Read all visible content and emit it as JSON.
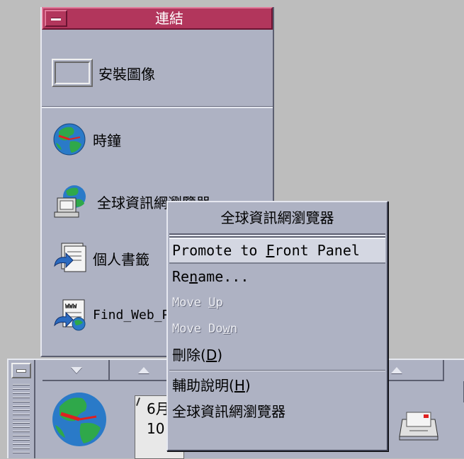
{
  "subpanel": {
    "title": "連結",
    "install_label": "安裝圖像",
    "items": [
      {
        "label": "時鐘",
        "icon": "globe-clock-icon"
      },
      {
        "label": "全球資訊網瀏覽器",
        "icon": "web-browser-icon"
      },
      {
        "label": "個人書籤",
        "icon": "bookmark-icon"
      },
      {
        "label": "Find_Web_Page",
        "icon": "find-web-page-icon"
      }
    ]
  },
  "context_menu": {
    "title": "全球資訊網瀏覽器",
    "items": [
      {
        "pre": "Promote to ",
        "mn": "F",
        "post": "ront Panel",
        "state": "active"
      },
      {
        "pre": "Re",
        "mn": "n",
        "post": "ame...",
        "state": "normal"
      },
      {
        "pre": "Move ",
        "mn": "U",
        "post": "p",
        "state": "disabled"
      },
      {
        "pre": "Move Do",
        "mn": "w",
        "post": "n",
        "state": "disabled"
      },
      {
        "pre": "刪除(",
        "mn": "D",
        "post": ")",
        "state": "normal"
      },
      {
        "pre": "輔助說明(",
        "mn": "H",
        "post": ")",
        "state": "normal"
      },
      {
        "pre": "全球資訊網瀏覽器",
        "mn": "",
        "post": "",
        "state": "normal"
      }
    ]
  },
  "front_panel": {
    "date_line1": "6月",
    "date_line2": "10"
  },
  "colors": {
    "panel": "#aeb2c3",
    "title_active": "#b2365c",
    "menu_highlight": "#d4d7e2"
  }
}
